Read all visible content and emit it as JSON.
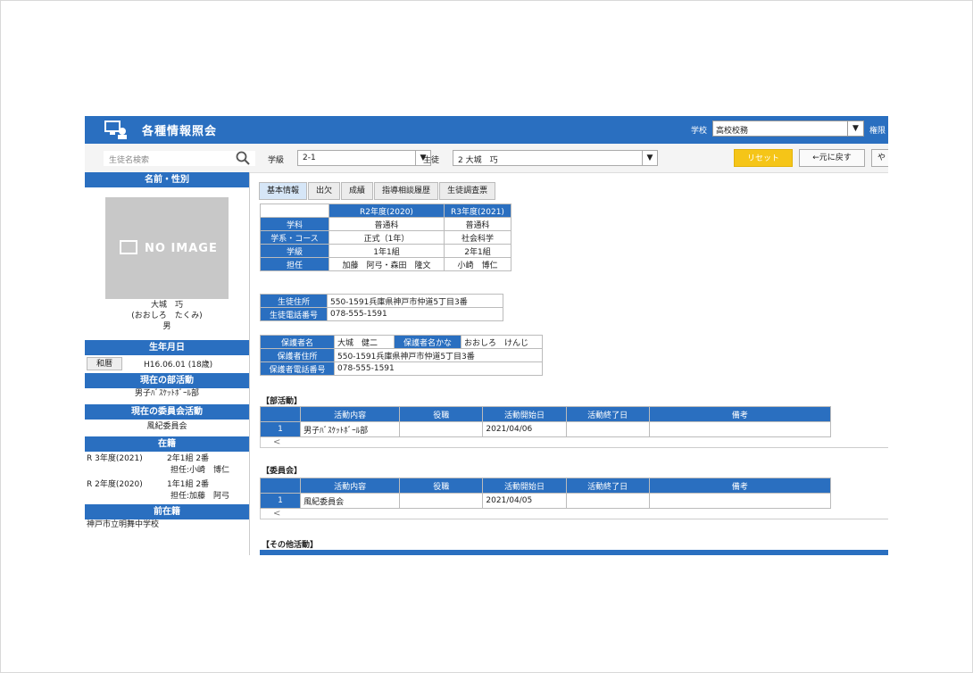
{
  "header": {
    "title": "各種情報照会",
    "school_label": "学校",
    "school_value": "高校校務",
    "priv_label": "権限"
  },
  "toolbar": {
    "search_placeholder": "生徒名検索",
    "class_label": "学級",
    "class_value": "2-1",
    "student_label": "生徒",
    "student_value": "2 大城　巧",
    "reset": "リセット",
    "back": "←元に戻す",
    "more": "や"
  },
  "left": {
    "name_gender": "名前・性別",
    "no_image": "NO IMAGE",
    "name": "大城　巧",
    "kana": "(おおしろ　たくみ)",
    "gender": "男",
    "birthday_head": "生年月日",
    "era_button": "和暦",
    "birthday": "H16.06.01 (18歳)",
    "club_head": "現在の部活動",
    "club": "男子ﾊﾞｽｹｯﾄﾎﾞｰﾙ部",
    "committee_head": "現在の委員会活動",
    "committee": "風紀委員会",
    "enrollment_head": "在籍",
    "enrollment": [
      {
        "year": "R 3年度(2021)",
        "class": "2年1組 2番",
        "teacher": "担任:小崎　博仁"
      },
      {
        "year": "R 2年度(2020)",
        "class": "1年1組 2番",
        "teacher": "担任:加藤　阿弓"
      }
    ],
    "prev_head": "前在籍",
    "prev_school": "神戸市立明舞中学校"
  },
  "tabs": [
    "基本情報",
    "出欠",
    "成績",
    "指導相談履歴",
    "生徒調査票"
  ],
  "basic": {
    "year_headers": [
      "R2年度(2020)",
      "R3年度(2021)"
    ],
    "rows": [
      {
        "label": "学科",
        "v1": "普通科",
        "v2": "普通科"
      },
      {
        "label": "学系・コース",
        "v1": "正式（1年）",
        "v2": "社会科学"
      },
      {
        "label": "学級",
        "v1": "1年1組",
        "v2": "2年1組"
      },
      {
        "label": "担任",
        "v1": "加藤　阿弓・森田　隆文",
        "v2": "小崎　博仁"
      }
    ]
  },
  "student_contact": {
    "address_label": "生徒住所",
    "address": "550-1591兵庫県神戸市仲道5丁目3番",
    "phone_label": "生徒電話番号",
    "phone": "078-555-1591"
  },
  "guardian": {
    "name_label": "保護者名",
    "name": "大城　健二",
    "kana_label": "保護者名かな",
    "kana": "おおしろ　けんじ",
    "address_label": "保護者住所",
    "address": "550-1591兵庫県神戸市仲道5丁目3番",
    "phone_label": "保護者電話番号",
    "phone": "078-555-1591"
  },
  "activity_columns": [
    "活動内容",
    "役職",
    "活動開始日",
    "活動終了日",
    "備考"
  ],
  "club_section": {
    "title": "【部活動】",
    "row": {
      "no": "1",
      "content": "男子ﾊﾞｽｹｯﾄﾎﾞｰﾙ部",
      "role": "",
      "start": "2021/04/06",
      "end": "",
      "note": ""
    }
  },
  "committee_section": {
    "title": "【委員会】",
    "row": {
      "no": "1",
      "content": "風紀委員会",
      "role": "",
      "start": "2021/04/05",
      "end": "",
      "note": ""
    }
  },
  "other_section": {
    "title": "【その他活動】"
  },
  "colors": {
    "primary": "#2a6fc0",
    "reset": "#f5c518"
  }
}
